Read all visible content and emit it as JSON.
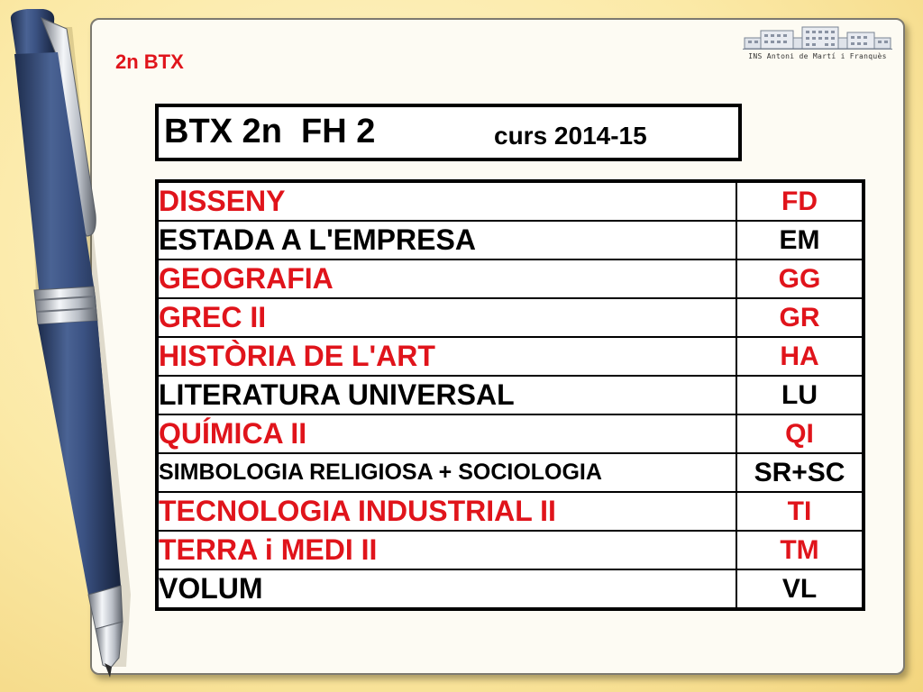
{
  "slide_title": "2n BTX",
  "logo": {
    "caption": "INS Antoni de Martí i Franquès",
    "icon": "school-building-icon"
  },
  "header": {
    "main": "BTX 2n  FH 2",
    "year": "curs 2014-15"
  },
  "colors": {
    "accent_red": "#e0141b",
    "text_black": "#000000",
    "paper": "#fdfbf3",
    "background": "#fbe9a6",
    "pen_body": "#3e5583"
  },
  "subjects": [
    {
      "name": "DISSENY",
      "code": "FD",
      "color": "red"
    },
    {
      "name": "ESTADA A L'EMPRESA",
      "code": "EM",
      "color": "black"
    },
    {
      "name": "GEOGRAFIA",
      "code": "GG",
      "color": "red"
    },
    {
      "name": "GREC II",
      "code": "GR",
      "color": "red"
    },
    {
      "name": "HISTÒRIA DE L'ART",
      "code": "HA",
      "color": "red"
    },
    {
      "name": "LITERATURA UNIVERSAL",
      "code": "LU",
      "color": "black"
    },
    {
      "name": "QUÍMICA II",
      "code": "QI",
      "color": "red"
    },
    {
      "name": "SIMBOLOGIA RELIGIOSA + SOCIOLOGIA",
      "code": "SR+SC",
      "color": "black"
    },
    {
      "name": "TECNOLOGIA INDUSTRIAL II",
      "code": "TI",
      "color": "red"
    },
    {
      "name": "TERRA i MEDI II",
      "code": "TM",
      "color": "red"
    },
    {
      "name": "VOLUM",
      "code": "VL",
      "color": "black"
    }
  ]
}
